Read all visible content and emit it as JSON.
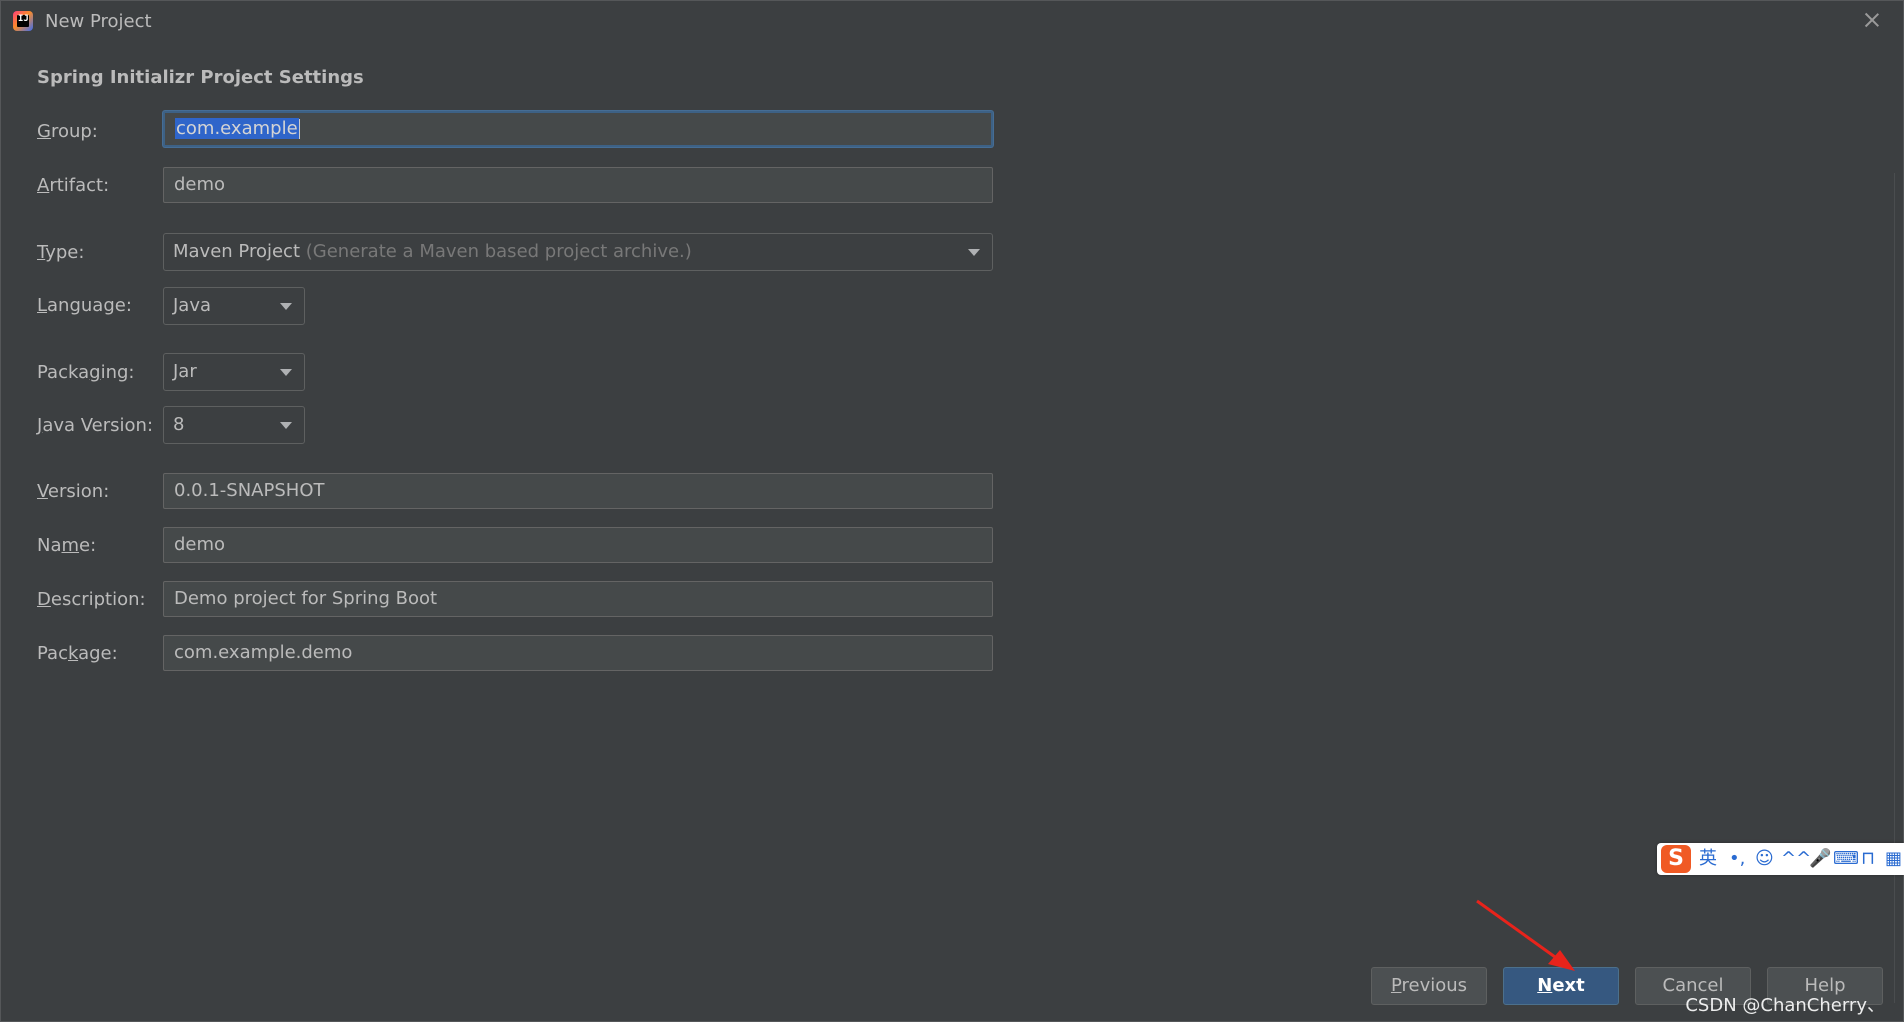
{
  "window": {
    "title": "New Project",
    "section_title": "Spring Initializr Project Settings"
  },
  "form": {
    "group": {
      "label_prefix": "",
      "label_mnemonic": "G",
      "label_rest": "roup:",
      "value": "com.example"
    },
    "artifact": {
      "label_prefix": "",
      "label_mnemonic": "A",
      "label_rest": "rtifact:",
      "value": "demo"
    },
    "type": {
      "label_prefix": "",
      "label_mnemonic": "T",
      "label_rest": "ype:",
      "value": "Maven Project",
      "hint": "(Generate a Maven based project archive.)"
    },
    "language": {
      "label_prefix": "",
      "label_mnemonic": "L",
      "label_rest": "anguage:",
      "value": "Java"
    },
    "packaging": {
      "label_prefix": "Packa",
      "label_mnemonic": "g",
      "label_rest": "ing:",
      "value": "Jar"
    },
    "java_version": {
      "label_prefix": "",
      "label_mnemonic": "J",
      "label_rest": "ava Version:",
      "value": "8"
    },
    "version": {
      "label_prefix": "",
      "label_mnemonic": "V",
      "label_rest": "ersion:",
      "value": "0.0.1-SNAPSHOT"
    },
    "name": {
      "label_prefix": "Na",
      "label_mnemonic": "m",
      "label_rest": "e:",
      "value": "demo"
    },
    "description": {
      "label_prefix": "",
      "label_mnemonic": "D",
      "label_rest": "escription:",
      "value": "Demo project for Spring Boot"
    },
    "package": {
      "label_prefix": "Pac",
      "label_mnemonic": "k",
      "label_rest": "age:",
      "value": "com.example.demo"
    }
  },
  "buttons": {
    "previous": {
      "mnemonic": "P",
      "rest": "revious"
    },
    "next": {
      "mnemonic": "N",
      "rest": "ext"
    },
    "cancel": {
      "label": "Cancel"
    },
    "help": {
      "label": "Help"
    }
  },
  "ime_bar": {
    "logo": "S",
    "items": [
      "英",
      "•,",
      "☺",
      "^^",
      "🎤",
      "⌨",
      "⊓",
      "▦"
    ]
  },
  "watermark": "CSDN @ChanCherry、",
  "colors": {
    "background": "#3c3f41",
    "field_bg": "#45494a",
    "primary_button": "#365880",
    "selection": "#2f65ca",
    "annotation_arrow": "#e8231b"
  }
}
